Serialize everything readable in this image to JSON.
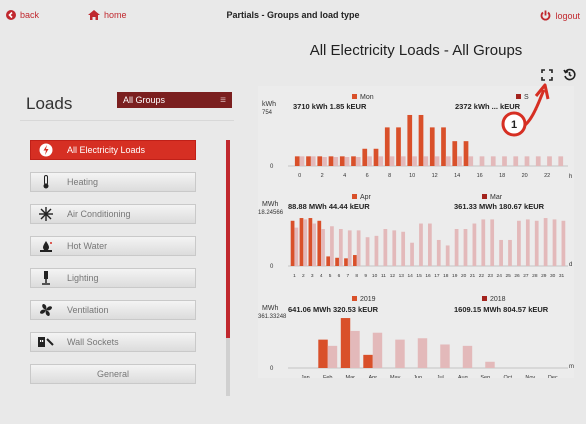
{
  "header": {
    "back_label": "back",
    "home_label": "home",
    "title": "Partials - Groups and load type",
    "logout_label": "logout"
  },
  "main_title": "All Electricity Loads - All Groups",
  "sidebar": {
    "title": "Loads",
    "group_select": "All Groups",
    "items": [
      {
        "label": "All Electricity Loads",
        "icon": "lightning-icon",
        "active": true
      },
      {
        "label": "Heating",
        "icon": "thermometer-icon",
        "active": false
      },
      {
        "label": "Air Conditioning",
        "icon": "snowflake-icon",
        "active": false
      },
      {
        "label": "Hot Water",
        "icon": "water-tap-icon",
        "active": false
      },
      {
        "label": "Lighting",
        "icon": "lamp-icon",
        "active": false
      },
      {
        "label": "Ventilation",
        "icon": "fan-icon",
        "active": false
      },
      {
        "label": "Wall Sockets",
        "icon": "plug-icon",
        "active": false
      },
      {
        "label": "General",
        "icon": "",
        "active": false
      }
    ]
  },
  "annotation": "1",
  "colors": {
    "accent": "#c0282e",
    "current": "#d9502a",
    "prev": "#e3b9ba",
    "current_dark": "#a3231d"
  },
  "chart_data": [
    {
      "type": "bar",
      "ylabel": "kWh",
      "ymax_label": "754",
      "ymin_label": "0",
      "ylim": [
        0,
        754
      ],
      "x_unit": "h",
      "categories": [
        "0",
        "1",
        "2",
        "3",
        "4",
        "5",
        "6",
        "7",
        "8",
        "9",
        "10",
        "11",
        "12",
        "13",
        "14",
        "15",
        "16",
        "17",
        "18",
        "19",
        "20",
        "21",
        "22",
        "23"
      ],
      "tick_labels": [
        "0",
        "2",
        "4",
        "6",
        "8",
        "10",
        "12",
        "14",
        "16",
        "18",
        "20",
        "22"
      ],
      "series": [
        {
          "name": "Mon",
          "summary": "3710 kWh 1.85 kEUR",
          "values": [
            140,
            140,
            140,
            140,
            140,
            140,
            250,
            250,
            560,
            560,
            740,
            740,
            560,
            560,
            360,
            360,
            0,
            0,
            0,
            0,
            0,
            0,
            0,
            0
          ]
        },
        {
          "name": "S",
          "summary": "2372 kWh ... kEUR",
          "values": [
            140,
            140,
            130,
            130,
            130,
            130,
            140,
            140,
            140,
            140,
            140,
            140,
            140,
            140,
            140,
            140,
            140,
            140,
            140,
            140,
            140,
            140,
            140,
            140
          ]
        }
      ]
    },
    {
      "type": "bar",
      "ylabel": "MWh",
      "ymax_label": "18.24566",
      "ymin_label": "0",
      "ylim": [
        0,
        18.24566
      ],
      "x_unit": "d",
      "categories": [
        "1",
        "2",
        "3",
        "4",
        "5",
        "6",
        "7",
        "8",
        "9",
        "10",
        "11",
        "12",
        "13",
        "14",
        "15",
        "16",
        "17",
        "18",
        "19",
        "20",
        "21",
        "22",
        "23",
        "24",
        "25",
        "26",
        "27",
        "28",
        "29",
        "30",
        "31"
      ],
      "series": [
        {
          "name": "Apr",
          "summary": "88.88 MWh 44.44 kEUR",
          "values": [
            16.5,
            17.5,
            17.5,
            16.5,
            3.5,
            3.0,
            2.8,
            4.0,
            0,
            0,
            0,
            0,
            0,
            0,
            0,
            0,
            0,
            0,
            0,
            0,
            0,
            0,
            0,
            0,
            0,
            0,
            0,
            0,
            0,
            0,
            0
          ]
        },
        {
          "name": "Mar",
          "summary": "361.33 MWh 180.67 kEUR",
          "values": [
            14.0,
            17.0,
            15.5,
            13.5,
            14.5,
            13.5,
            13.0,
            13.0,
            10.5,
            11.0,
            13.5,
            13.0,
            12.5,
            8.5,
            15.5,
            15.5,
            9.5,
            7.5,
            13.5,
            13.5,
            15.5,
            17.0,
            17.0,
            9.5,
            9.5,
            16.5,
            17.0,
            16.5,
            17.5,
            17.0,
            16.5
          ]
        }
      ]
    },
    {
      "type": "bar",
      "ylabel": "MWh",
      "ymax_label": "361.33248",
      "ymin_label": "0",
      "ylim": [
        0,
        361.33248
      ],
      "x_unit": "m",
      "categories": [
        "Jan",
        "Feb",
        "Mar",
        "Apr",
        "May",
        "Jun",
        "Jul",
        "Aug",
        "Sep",
        "Oct",
        "Nov",
        "Dec"
      ],
      "series": [
        {
          "name": "2019",
          "summary": "641.06 MWh 320.53 kEUR",
          "values": [
            0,
            205,
            361,
            95,
            0,
            0,
            0,
            0,
            0,
            0,
            0,
            0
          ]
        },
        {
          "name": "2018",
          "summary": "1609.15 MWh 804.57 kEUR",
          "values": [
            0,
            160,
            268,
            255,
            205,
            215,
            170,
            160,
            45,
            0,
            0,
            0
          ]
        }
      ]
    }
  ]
}
